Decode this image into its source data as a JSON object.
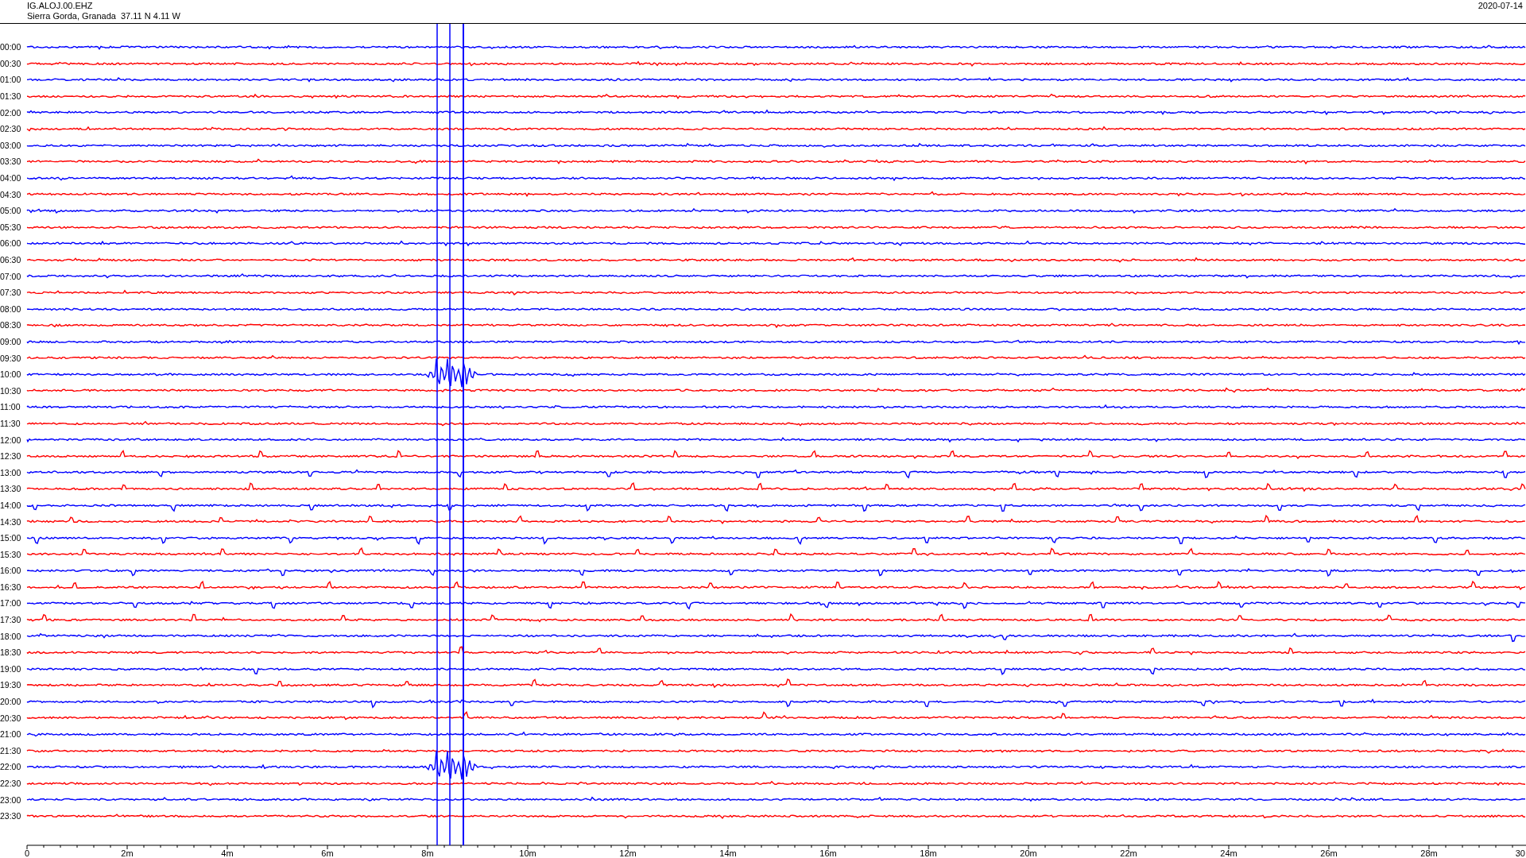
{
  "header": {
    "station": "IG.ALOJ.00.EHZ",
    "location": "Sierra Gorda, Granada  37.11 N 4.11 W",
    "date": "2020-07-14"
  },
  "rows": [
    {
      "time": "00:00",
      "color": "#0000ff"
    },
    {
      "time": "00:30",
      "color": "#ff0000"
    },
    {
      "time": "01:00",
      "color": "#0000ff"
    },
    {
      "time": "01:30",
      "color": "#ff0000"
    },
    {
      "time": "02:00",
      "color": "#0000ff"
    },
    {
      "time": "02:30",
      "color": "#ff0000"
    },
    {
      "time": "03:00",
      "color": "#0000ff"
    },
    {
      "time": "03:30",
      "color": "#ff0000"
    },
    {
      "time": "04:00",
      "color": "#0000ff"
    },
    {
      "time": "04:30",
      "color": "#ff0000"
    },
    {
      "time": "05:00",
      "color": "#0000ff"
    },
    {
      "time": "05:30",
      "color": "#ff0000"
    },
    {
      "time": "06:00",
      "color": "#0000ff"
    },
    {
      "time": "06:30",
      "color": "#ff0000"
    },
    {
      "time": "07:00",
      "color": "#0000ff"
    },
    {
      "time": "07:30",
      "color": "#ff0000"
    },
    {
      "time": "08:00",
      "color": "#0000ff"
    },
    {
      "time": "08:30",
      "color": "#ff0000"
    },
    {
      "time": "09:00",
      "color": "#0000ff"
    },
    {
      "time": "09:30",
      "color": "#ff0000"
    },
    {
      "time": "10:00",
      "color": "#0000ff"
    },
    {
      "time": "10:30",
      "color": "#ff0000"
    },
    {
      "time": "11:00",
      "color": "#0000ff"
    },
    {
      "time": "11:30",
      "color": "#ff0000"
    },
    {
      "time": "12:00",
      "color": "#0000ff"
    },
    {
      "time": "12:30",
      "color": "#ff0000"
    },
    {
      "time": "13:00",
      "color": "#0000ff"
    },
    {
      "time": "13:30",
      "color": "#ff0000"
    },
    {
      "time": "14:00",
      "color": "#0000ff"
    },
    {
      "time": "14:30",
      "color": "#ff0000"
    },
    {
      "time": "15:00",
      "color": "#0000ff"
    },
    {
      "time": "15:30",
      "color": "#ff0000"
    },
    {
      "time": "16:00",
      "color": "#0000ff"
    },
    {
      "time": "16:30",
      "color": "#ff0000"
    },
    {
      "time": "17:00",
      "color": "#0000ff"
    },
    {
      "time": "17:30",
      "color": "#ff0000"
    },
    {
      "time": "18:00",
      "color": "#0000ff"
    },
    {
      "time": "18:30",
      "color": "#ff0000"
    },
    {
      "time": "19:00",
      "color": "#0000ff"
    },
    {
      "time": "19:30",
      "color": "#ff0000"
    },
    {
      "time": "20:00",
      "color": "#0000ff"
    },
    {
      "time": "20:30",
      "color": "#ff0000"
    },
    {
      "time": "21:00",
      "color": "#0000ff"
    },
    {
      "time": "21:30",
      "color": "#ff0000"
    },
    {
      "time": "22:00",
      "color": "#0000ff"
    },
    {
      "time": "22:30",
      "color": "#ff0000"
    },
    {
      "time": "23:00",
      "color": "#0000ff"
    },
    {
      "time": "23:30",
      "color": "#ff0000"
    }
  ],
  "axis": {
    "labels": [
      "0",
      "2m",
      "4m",
      "6m",
      "8m",
      "10m",
      "12m",
      "14m",
      "16m",
      "18m",
      "20m",
      "22m",
      "24m",
      "26m",
      "28m",
      "30"
    ]
  }
}
